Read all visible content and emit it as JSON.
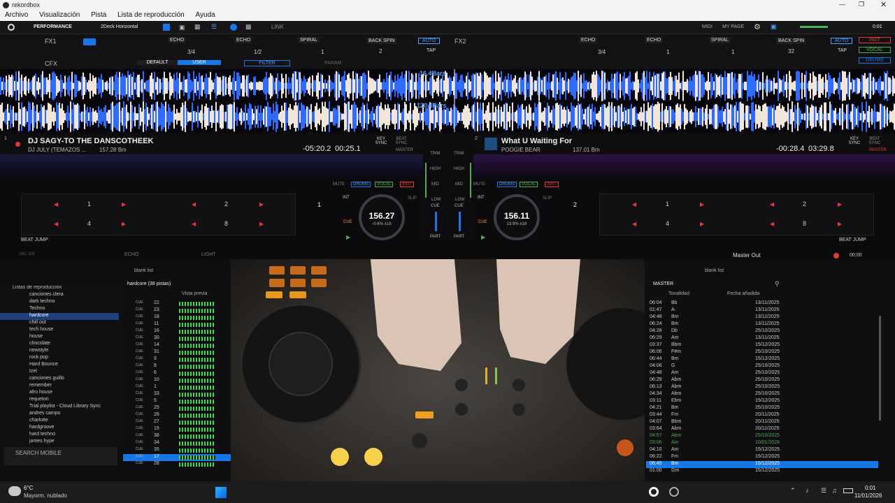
{
  "window": {
    "title": "rekordbox"
  },
  "menu": [
    "Archivo",
    "Visualización",
    "Pista",
    "Lista de reproducción",
    "Ayuda"
  ],
  "toolbar": {
    "mode": "PERFORMANCE",
    "layout": "2Deck Horizontal",
    "link": "LINK",
    "midi": "MIDI",
    "mypage": "MY PAGE",
    "clock": "0:01"
  },
  "fx": {
    "fx1": "FX1",
    "fx2": "FX2",
    "cfx": "CFX",
    "fx1_slots": [
      "ECHO",
      "ECHO",
      "SPIRAL",
      "BACK SPIN"
    ],
    "fx1_beats": [
      "3/4",
      "1/2",
      "1",
      "2"
    ],
    "fx2_slots": [
      "ECHO",
      "ECHO",
      "SPIRAL",
      "BACK SPIN"
    ],
    "fx2_beats": [
      "3/4",
      "1",
      "1",
      "32"
    ],
    "auto": "AUTO",
    "tap": "TAP",
    "cfx_default": "DEFAULT",
    "cfx_user": "USER",
    "cfx_filter": "FILTER",
    "cfx_param": "PARAM",
    "inst": "INST",
    "vocal": "VOCAL",
    "drums": "DRUMS"
  },
  "waves": {
    "bars1": "16.4Bars",
    "bars2": "120.4Bars"
  },
  "deck1": {
    "num": "1",
    "title": "DJ SAGY-TO THE DANSCOTHEEK",
    "artist": "DJ JULY (TEMAZOS ...",
    "bpm_small": "157.28 Bm",
    "remain": "-05:20.2",
    "elapsed": "00:25.1",
    "jog_bpm": "156.27",
    "jog_pct": "-0.6%  ±16",
    "key": "KEY SYNC",
    "beat": "BEAT SYNC",
    "master": "MASTER",
    "pads": [
      "1",
      "2",
      "4",
      "8"
    ],
    "beatjump": "BEAT JUMP",
    "int": "INT",
    "cue": "CUE",
    "slip": "SLIP",
    "counter": "1"
  },
  "deck2": {
    "num": "2",
    "title": "What U Waiting For",
    "artist": "POOGIE BEAR",
    "bpm_small": "137.01 Bm",
    "remain": "-00:28.4",
    "elapsed": "03:29.8",
    "jog_bpm": "156.11",
    "jog_pct": "13.9%  ±16",
    "key": "KEY SYNC",
    "beat": "BEAT SYNC",
    "master": "MASTER",
    "pads": [
      "1",
      "2",
      "4",
      "8"
    ],
    "beatjump": "BEAT JUMP",
    "int": "INT",
    "cue": "CUE",
    "slip": "SLIP",
    "counter": "2"
  },
  "mixer": {
    "trim": "TRIM",
    "high": "HIGH",
    "mid": "MID",
    "low": "LOW",
    "cue": "CUE",
    "part": "PART"
  },
  "stems": {
    "mute": "MUTE",
    "drums": "DRUMS",
    "vocal": "VOCAL",
    "inst": "INST"
  },
  "lowerbar": {
    "echo": "ECHO",
    "light": "LIGHT",
    "mic": "MIC ON",
    "master_out": "Master Out",
    "time": "00:00"
  },
  "browser": {
    "playlists_header": "Listas de reproducción",
    "playlists": [
      "canciones clera",
      "dark techno",
      "Techno",
      "hardcore",
      "chill out",
      "tech house",
      "house",
      "chocolate",
      "newstyle",
      "rock pop",
      "Hard Bounce",
      "tzel",
      "canciones guillo",
      "remember",
      "afro house",
      "requeton",
      "Trial playlist - Cloud Library Sync",
      "andres campo",
      "charlotte",
      "hardgroove",
      "hard techno",
      "james hype"
    ],
    "selected_playlist": "hardcore",
    "blank_list": "blank list",
    "list_title": "hardcore (38 pistas)",
    "col_preview": "Vista previa",
    "left_rows": [
      "22",
      "23",
      "18",
      "11",
      "16",
      "30",
      "14",
      "31",
      "9",
      "8",
      "6",
      "10",
      "1",
      "33",
      "5",
      "25",
      "26",
      "27",
      "15",
      "38",
      "34",
      "35",
      "17",
      "28"
    ],
    "cue_label": "CUE",
    "search_mobile": "SEARCH MOBILE",
    "master": "MASTER",
    "col_key": "Tonalidad",
    "col_date": "Fecha añadida",
    "right_rows": [
      [
        "06:04",
        "Bb",
        "13/11/2025"
      ],
      [
        "01:47",
        "A",
        "13/11/2025"
      ],
      [
        "04:48",
        "Bm",
        "13/11/2025"
      ],
      [
        "06:24",
        "Bm",
        "13/11/2025"
      ],
      [
        "04:28",
        "Db",
        "25/10/2025"
      ],
      [
        "06:29",
        "Am",
        "13/11/2025"
      ],
      [
        "03:37",
        "Bbm",
        "15/12/2025"
      ],
      [
        "06:06",
        "F#m",
        "25/10/2025"
      ],
      [
        "06:44",
        "Bm",
        "15/12/2025"
      ],
      [
        "04:06",
        "G",
        "25/10/2025"
      ],
      [
        "04:48",
        "Am",
        "25/10/2025"
      ],
      [
        "06:29",
        "Abm",
        "25/10/2025"
      ],
      [
        "06:13",
        "Abm",
        "25/10/2025"
      ],
      [
        "04:34",
        "Abm",
        "25/10/2025"
      ],
      [
        "03:11",
        "Ebm",
        "15/12/2025"
      ],
      [
        "04:21",
        "Bm",
        "25/10/2025"
      ],
      [
        "03:44",
        "Fm",
        "20/11/2025"
      ],
      [
        "04:07",
        "Bbm",
        "20/11/2025"
      ],
      [
        "03:64",
        "Abm",
        "20/11/2025"
      ],
      [
        "04:57",
        "Abm",
        "25/10/2025"
      ],
      [
        "03:06",
        "Am",
        "10/01/2026"
      ],
      [
        "04:10",
        "Am",
        "15/12/2025"
      ],
      [
        "06:22",
        "Fm",
        "15/12/2025"
      ],
      [
        "06:45",
        "Bm",
        "15/12/2025"
      ],
      [
        "01:00",
        "Gm",
        "15/12/2025"
      ]
    ]
  },
  "taskbar": {
    "temp": "6°C",
    "weather": "Mayorm. nublado",
    "time": "0:01",
    "date": "11/01/2026"
  },
  "colors": {
    "accent": "#1677e6",
    "waveBlue": "#2e6bff",
    "red": "#e53935",
    "green": "#4caf50"
  }
}
